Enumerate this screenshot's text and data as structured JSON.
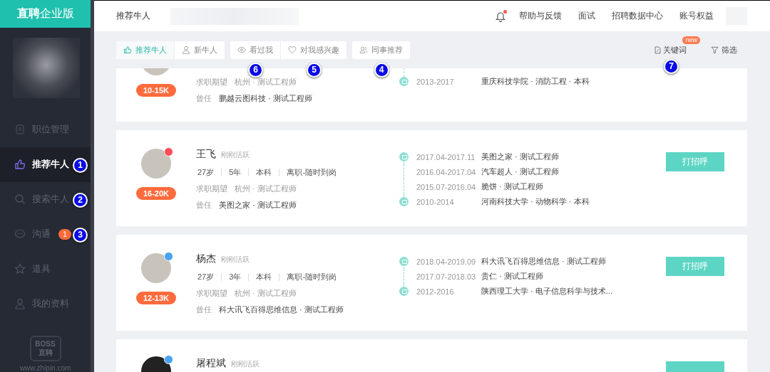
{
  "sidebar": {
    "logo": {
      "bold": "直聘",
      "rest": "企业版"
    },
    "items": [
      {
        "label": "职位管理",
        "selected": false
      },
      {
        "label": "推荐牛人",
        "selected": true,
        "marker": "1"
      },
      {
        "label": "搜索牛人",
        "selected": false,
        "marker": "2"
      },
      {
        "label": "沟通",
        "selected": false,
        "badge": "1",
        "marker": "3"
      },
      {
        "label": "道具",
        "selected": false
      },
      {
        "label": "我的资料",
        "selected": false
      }
    ],
    "watermark": {
      "line1": "BOSS",
      "line2": "直聘",
      "url": "www.zhipin.com"
    }
  },
  "topbar": {
    "title": "推荐牛人",
    "notification_dot": true,
    "links": [
      "帮助与反馈",
      "面试",
      "招聘数据中心",
      "账号权益"
    ]
  },
  "toolbar": {
    "groups": [
      {
        "tabs": [
          {
            "label": "推荐牛人",
            "selected": true
          },
          {
            "label": "新牛人",
            "selected": false
          }
        ]
      },
      {
        "tabs": [
          {
            "label": "看过我",
            "selected": false,
            "marker": "6"
          },
          {
            "label": "对我感兴趣",
            "selected": false,
            "marker": "5"
          }
        ]
      },
      {
        "tabs": [
          {
            "label": "同事推荐",
            "selected": false,
            "marker": "4"
          }
        ]
      }
    ],
    "keyword": {
      "label": "关键词",
      "badge": "new",
      "marker": "7"
    },
    "filter": {
      "label": "筛选"
    }
  },
  "candidates": [
    {
      "kind": "scrolled-top",
      "salary": "10-15K",
      "expect_label": "求职期望",
      "expect": "杭州 · 测试工程师",
      "past_label": "曾任",
      "past": "鹏越云图科技 · 测试工程师",
      "timeline": [
        {
          "kind": "school",
          "date": "2013-2017",
          "detail": "重庆科技学院  · 消防工程  · 本科"
        }
      ]
    },
    {
      "kind": "full",
      "name": "王飞",
      "status": "刚刚活跃",
      "color": "#ff4d5a",
      "facts": [
        "27岁",
        "5年",
        "本科",
        "离职-随时到岗"
      ],
      "salary": "16-20K",
      "expect_label": "求职期望",
      "expect": "杭州 · 测试工程师",
      "past_label": "曾任",
      "past": "美图之家 · 测试工程师",
      "button": "打招呼",
      "timeline": [
        {
          "kind": "work",
          "date": "2017.04-2017.11",
          "detail": "美图之家  · 测试工程师"
        },
        {
          "kind": "work-continued",
          "date": "2016.04-2017.04",
          "detail": "汽车超人  · 测试工程师"
        },
        {
          "kind": "work-continued",
          "date": "2015.07-2016.04",
          "detail": "脆饼  · 测试工程师"
        },
        {
          "kind": "school",
          "date": "2010-2014",
          "detail": "河南科技大学  · 动物科学  · 本科"
        }
      ]
    },
    {
      "kind": "full",
      "name": "杨杰",
      "status": "刚刚活跃",
      "color": "#4aa3f0",
      "facts": [
        "27岁",
        "3年",
        "本科",
        "离职-随时到岗"
      ],
      "salary": "12-13K",
      "expect_label": "求职期望",
      "expect": "杭州 · 测试工程师",
      "past_label": "曾任",
      "past": "科大讯飞百得思维信息 · 测试工程师",
      "button": "打招呼",
      "timeline": [
        {
          "kind": "work",
          "date": "2018.04-2019.09",
          "detail": "科大讯飞百得思维信息  · 测试工程师"
        },
        {
          "kind": "work-continued",
          "date": "2017.07-2018.03",
          "detail": "贵仁  · 测试工程师"
        },
        {
          "kind": "school",
          "date": "2012-2016",
          "detail": "陕西理工大学  · 电子信息科学与技术..."
        }
      ]
    },
    {
      "kind": "scrolled-bottom",
      "name": "屠程斌",
      "status": "刚刚活跃",
      "color": "#4aa3f0"
    }
  ]
}
